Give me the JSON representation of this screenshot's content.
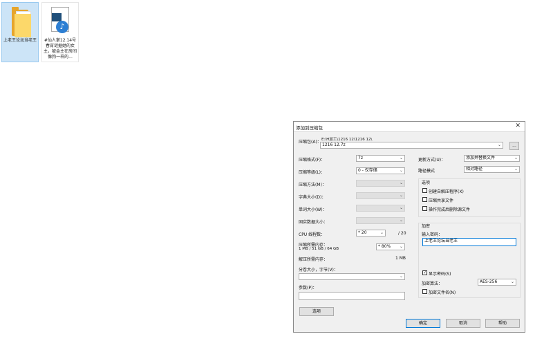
{
  "desktop": {
    "icons": [
      {
        "label": "上老王论坛当老王",
        "icon": "folder-icon"
      },
      {
        "label": "#仙人掌12.14号春宵谜据她的女主，被金主在房间像狗一样的..."
      }
    ]
  },
  "dialog": {
    "title": "添加到压缩包",
    "close": "✕",
    "archive_label": "压缩包(A)：",
    "archive_path": "E:\\H加工\\1216 12\\1216 12\\",
    "archive_name": "1216 12.7z",
    "browse_label": "...",
    "format_label": "压缩格式(F)：",
    "format_value": "7z",
    "level_label": "压缩等级(L)：",
    "level_value": "0 - 仅存储",
    "method_label": "压缩方法(M)：",
    "dict_label": "字典大小(D)：",
    "word_label": "单词大小(W)：",
    "solid_label": "固实数据大小：",
    "threads_label": "CPU 线程数：",
    "threads_value": "* 20",
    "threads_total": "/ 20",
    "mem_label": "压缩所需内存：",
    "mem_detail": "1 MB / 51 GB / 64 GB",
    "mem_value": "* 80%",
    "decomp_label": "解压所需内存：",
    "decomp_value": "1 MB",
    "split_label": "分卷大小，字节(V)：",
    "params_label": "参数(P)：",
    "options_button": "选项",
    "update_label": "更新方式(U)：",
    "update_value": "添加并替换文件",
    "path_label": "路径模式",
    "path_value": "相对路径",
    "options_group": "选项",
    "opt1": "创建自解压程序(X)",
    "opt2": "压缩共享文件",
    "opt3": "操作完成后删除源文件",
    "encrypt_group": "加密",
    "pwd_label": "输入密码：",
    "pwd_value": "上老王论坛当老王",
    "show_pwd": "显示密码(S)",
    "enc_method_label": "加密算法：",
    "enc_method_value": "AES-256",
    "enc_names": "加密文件名(N)",
    "ok": "确定",
    "cancel": "取消",
    "help": "帮助",
    "check_mark": "✓",
    "dropdown_arrow": "⌄"
  }
}
